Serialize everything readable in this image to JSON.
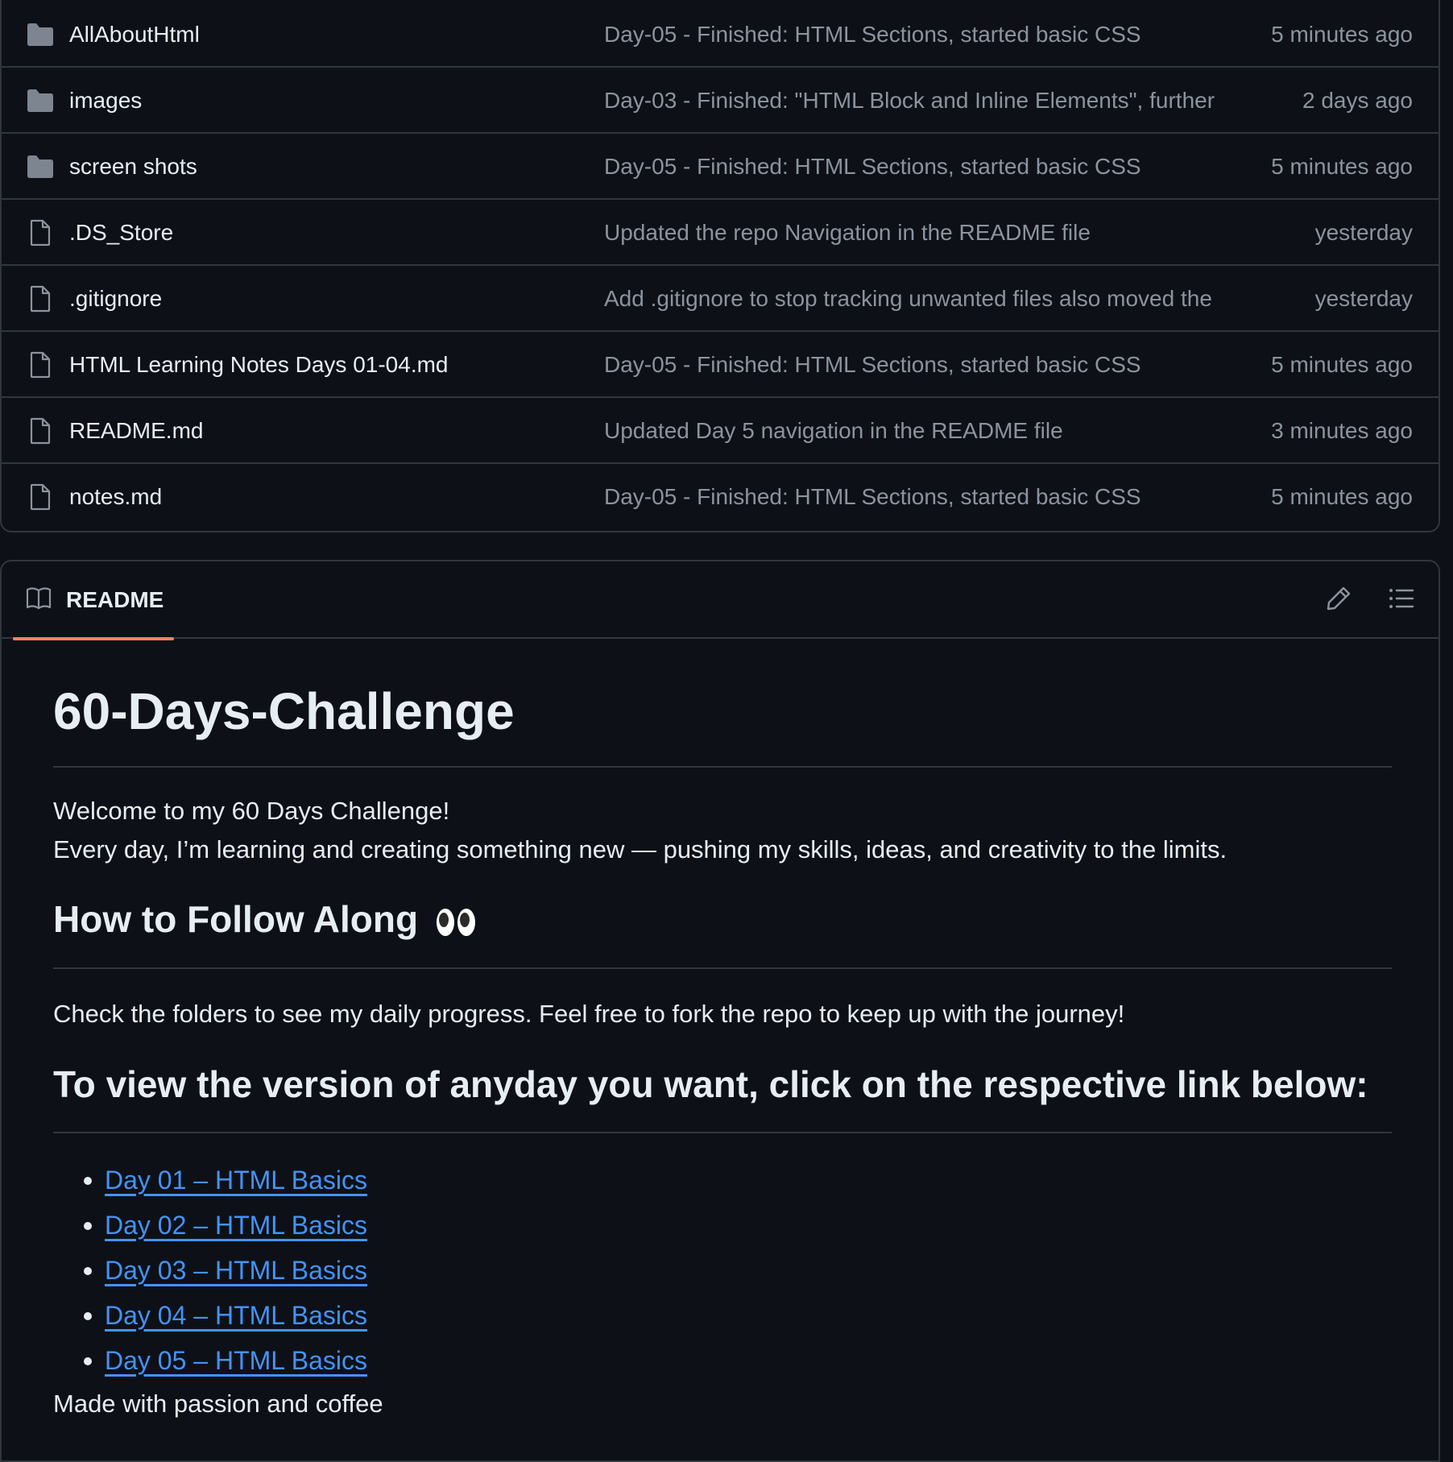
{
  "files": [
    {
      "type": "folder",
      "name": "AllAboutHtml",
      "message": "Day-05 - Finished: HTML Sections, started basic CSS",
      "time": "5 minutes ago"
    },
    {
      "type": "folder",
      "name": "images",
      "message": "Day-03 - Finished: \"HTML Block and Inline Elements\", further",
      "time": "2 days ago"
    },
    {
      "type": "folder",
      "name": "screen shots",
      "message": "Day-05 - Finished: HTML Sections, started basic CSS",
      "time": "5 minutes ago"
    },
    {
      "type": "file",
      "name": ".DS_Store",
      "message": "Updated the repo Navigation in the README file",
      "time": "yesterday"
    },
    {
      "type": "file",
      "name": ".gitignore",
      "message": "Add .gitignore to stop tracking unwanted files also moved the",
      "time": "yesterday"
    },
    {
      "type": "file",
      "name": "HTML Learning Notes Days 01-04.md",
      "message": "Day-05 - Finished: HTML Sections, started basic CSS",
      "time": "5 minutes ago"
    },
    {
      "type": "file",
      "name": "README.md",
      "message": "Updated Day 5 navigation in the README file",
      "time": "3 minutes ago"
    },
    {
      "type": "file",
      "name": "notes.md",
      "message": "Day-05 - Finished: HTML Sections, started basic CSS",
      "time": "5 minutes ago"
    }
  ],
  "readme": {
    "tab_label": "README",
    "edit_icon": "pencil-icon",
    "outline_icon": "list-icon",
    "title": "60-Days-Challenge",
    "intro_line1": "Welcome to my 60 Days Challenge!",
    "intro_line2": "Every day, I’m learning and creating something new — pushing my skills, ideas, and creativity to the limits.",
    "follow_heading": "How to Follow Along",
    "follow_emoji": "eyes-emoji",
    "follow_text": "Check the folders to see my daily progress. Feel free to fork the repo to keep up with the journey!",
    "view_heading": "To view the version of anyday you want, click on the respective link below:",
    "links": [
      "Day 01 – HTML Basics",
      "Day 02 – HTML Basics",
      "Day 03 – HTML Basics",
      "Day 04 – HTML Basics",
      "Day 05 – HTML Basics"
    ],
    "trailing_text": "Made with passion and coffee"
  },
  "colors": {
    "background": "#0d1117",
    "border": "#30363d",
    "text": "#e6edf3",
    "muted": "#8b949e",
    "link": "#4493f8",
    "tab_accent": "#f78166",
    "folder": "#7d8590"
  }
}
